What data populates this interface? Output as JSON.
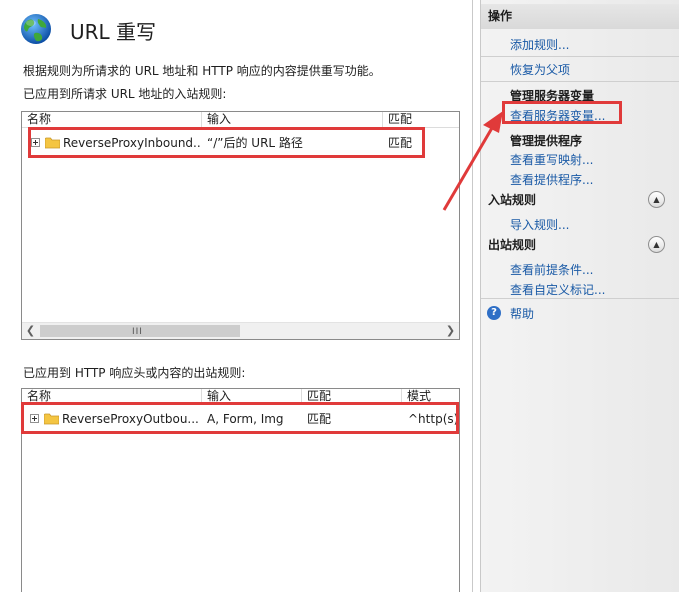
{
  "page": {
    "title": "URL 重写",
    "description": "根据规则为所请求的 URL 地址和 HTTP 响应的内容提供重写功能。",
    "inbound_label": "已应用到所请求 URL 地址的入站规则:",
    "outbound_label": "已应用到 HTTP 响应头或内容的出站规则:"
  },
  "inbound": {
    "columns": [
      "名称",
      "输入",
      "匹配"
    ],
    "rows": [
      {
        "name": "ReverseProxyInbound...",
        "input": "“/”后的 URL 路径",
        "match": "匹配"
      }
    ]
  },
  "outbound": {
    "columns": [
      "名称",
      "输入",
      "匹配",
      "模式"
    ],
    "rows": [
      {
        "name": "ReverseProxyOutbou...",
        "input": "A, Form, Img",
        "match": "匹配",
        "pattern": "^http(s)?"
      }
    ]
  },
  "actions": {
    "title": "操作",
    "add_rule": "添加规则...",
    "revert_parent": "恢复为父项",
    "server_vars_head": "管理服务器变量",
    "view_server_vars": "查看服务器变量...",
    "providers_head": "管理提供程序",
    "view_rewrite_maps": "查看重写映射...",
    "view_providers": "查看提供程序...",
    "inbound_head": "入站规则",
    "import_rules": "导入规则...",
    "outbound_head": "出站规则",
    "view_preconditions": "查看前提条件...",
    "view_custom_tags": "查看自定义标记...",
    "help": "帮助"
  },
  "icons": {
    "globe": "globe-icon",
    "folder": "folder-icon",
    "expand": "plus-expander-icon",
    "collapse": "chevron-up-icon",
    "help": "help-icon"
  },
  "colors": {
    "link": "#1a5aa6",
    "highlight": "#e03a3a",
    "actions_bg": "#eeeeee"
  }
}
